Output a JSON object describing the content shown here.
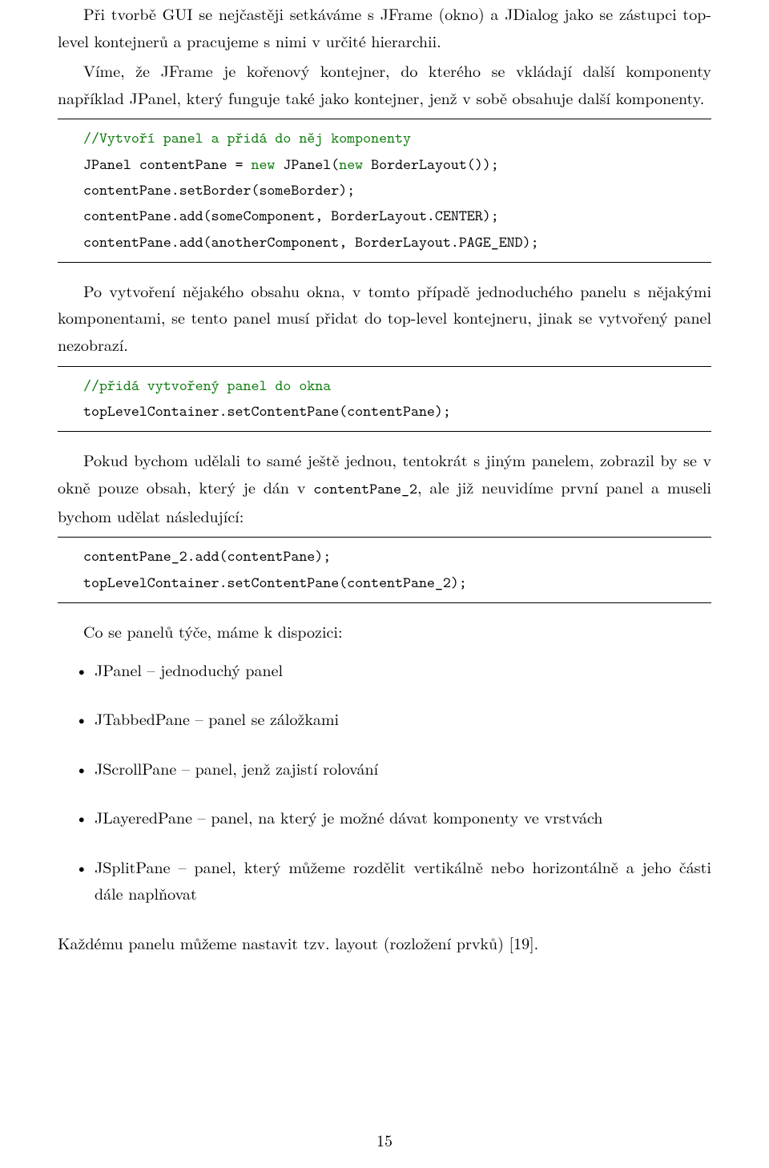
{
  "paragraphs": {
    "p1": "Při tvorbě GUI se nejčastěji setkáváme s JFrame (okno) a JDialog jako se zástupci top-level kontejnerů a pracujeme s nimi v určité hierarchii.",
    "p2": "Víme, že JFrame je kořenový kontejner, do kterého se vkládají další komponenty například JPanel, který funguje také jako kontejner, jenž v sobě obsahuje další komponenty.",
    "p3": "Po vytvoření nějakého obsahu okna, v tomto případě jednoduchého panelu s nějakými komponentami, se tento panel musí přidat do top-level kontejneru, jinak se vytvořený panel nezobrazí.",
    "p4a": "Pokud bychom udělali to samé ještě jednou, tentokrát s jiným panelem, zobrazil by se v okně pouze obsah, který je dán v ",
    "p4code": "contentPane_2",
    "p4b": ", ale již neuvidíme první panel a museli bychom udělat následující:",
    "p5": "Co se panelů týče, máme k dispozici:",
    "p6": "Každému panelu můžeme nastavit tzv. layout (rozložení prvků) [19]."
  },
  "code1": {
    "c1": "//Vytvoří panel a přidá do něj komponenty",
    "c2a": "JPanel contentPane = ",
    "c2k": "new",
    "c2b": " JPanel(",
    "c2k2": "new",
    "c2c": " BorderLayout());",
    "c3": "contentPane.setBorder(someBorder);",
    "c4": "contentPane.add(someComponent, BorderLayout.CENTER);",
    "c5": "contentPane.add(anotherComponent, BorderLayout.PAGE_END);"
  },
  "code2": {
    "c1": "//přidá vytvořený panel do okna",
    "c2": "topLevelContainer.setContentPane(contentPane);"
  },
  "code3": {
    "c1": "contentPane_2.add(contentPane);",
    "c2": "topLevelContainer.setContentPane(contentPane_2);"
  },
  "bullets": {
    "b1": "JPanel – jednoduchý panel",
    "b2": "JTabbedPane – panel se záložkami",
    "b3": "JScrollPane – panel, jenž zajistí rolování",
    "b4": "JLayeredPane – panel, na který je možné dávat komponenty ve vrstvách",
    "b5": "JSplitPane – panel, který můžeme rozdělit vertikálně nebo horizontálně a jeho části dále naplňovat"
  },
  "pageNumber": "15"
}
